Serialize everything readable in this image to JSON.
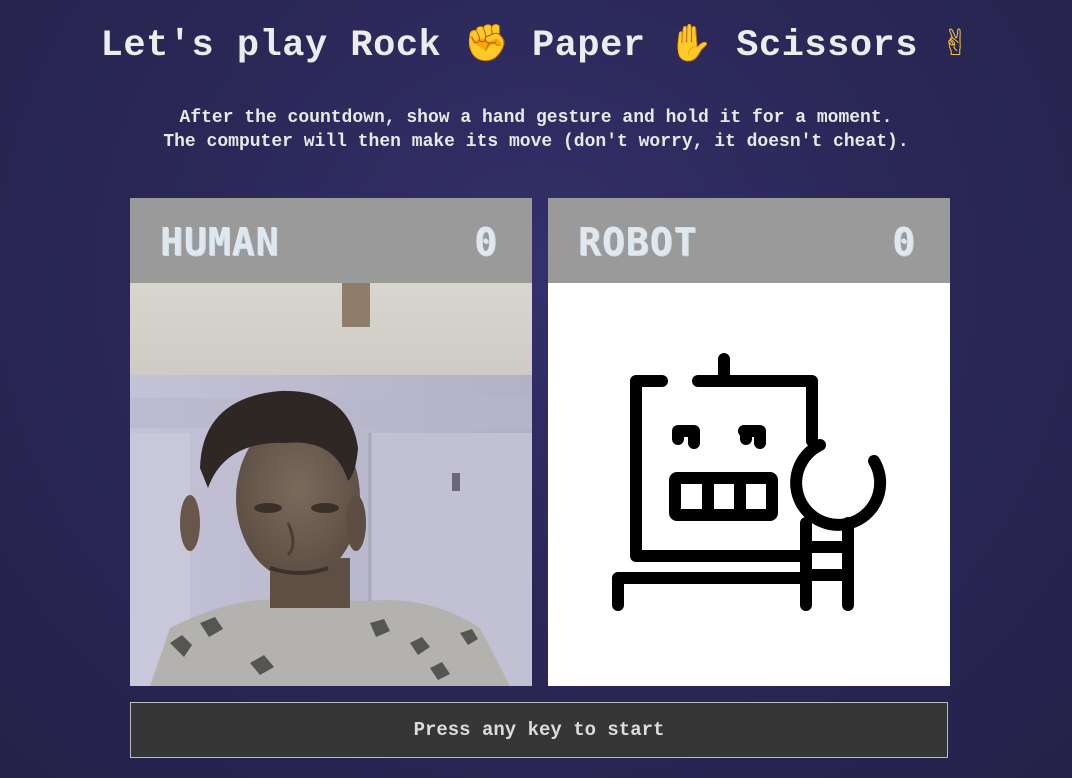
{
  "header": {
    "title_parts": [
      "Let's play Rock",
      "Paper",
      "Scissors"
    ],
    "title_emojis": [
      "✊",
      "✋",
      "✌"
    ],
    "subtitle_line1": "After the countdown, show a hand gesture and hold it for a moment.",
    "subtitle_line2": "The computer will then make its move (don't worry, it doesn't cheat)."
  },
  "players": {
    "human": {
      "name": "HUMAN",
      "score": "0"
    },
    "robot": {
      "name": "ROBOT",
      "score": "0"
    }
  },
  "start_prompt": "Press any key to start",
  "icons": {
    "rock": "raised-fist-icon",
    "paper": "raised-hand-icon",
    "scissors": "victory-hand-icon",
    "robot": "robot-icon"
  },
  "colors": {
    "background": "#2b2858",
    "panel_header": "#9a9a9a",
    "score_text": "#dfe8ee",
    "button_bg": "#363636"
  }
}
